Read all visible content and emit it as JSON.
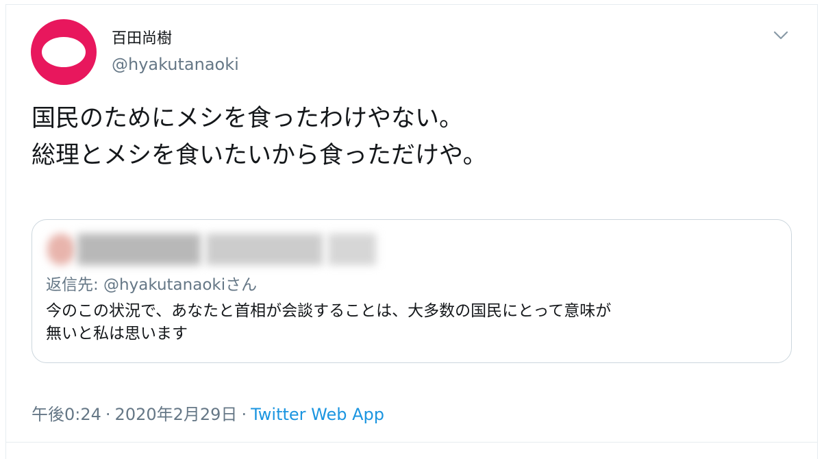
{
  "tweet": {
    "display_name": "百田尚樹",
    "handle": "@hyakutanaoki",
    "text_line1": "国民のためにメシを食ったわけやない。",
    "text_line2": "総理とメシを食いたいから食っただけや。",
    "quoted": {
      "reply_to": "返信先: @hyakutanaokiさん",
      "text_line1": "今のこの状況で、あなたと首相が会談することは、大多数の国民にとって意味が",
      "text_line2": "無いと私は思います"
    },
    "meta": {
      "time": "午後0:24",
      "date": "2020年2月29日",
      "separator": "·",
      "source_app": "Twitter Web App"
    }
  },
  "icons": {
    "caret": "chevron-down-icon"
  },
  "colors": {
    "avatar": "#e8175d",
    "link": "#1b95e0",
    "secondary_text": "#657786",
    "border": "#ccd6dd"
  }
}
